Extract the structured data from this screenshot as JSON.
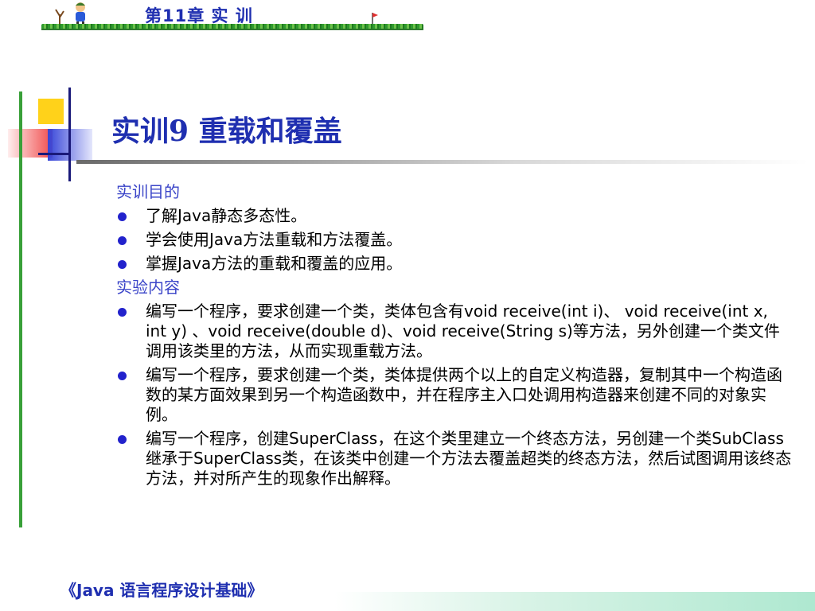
{
  "header": {
    "chapter_title": "第11章  实 训"
  },
  "slide": {
    "title": "实训9   重载和覆盖"
  },
  "content": {
    "sections": [
      {
        "heading": "实训目的",
        "items": [
          "了解Java静态多态性。",
          "学会使用Java方法重载和方法覆盖。",
          "掌握Java方法的重载和覆盖的应用。"
        ]
      },
      {
        "heading": "实验内容",
        "items": [
          "编写一个程序，要求创建一个类，类体包含有void receive(int i)、 void receive(int x, int y) 、void  receive(double d)、void  receive(String s)等方法，另外创建一个类文件调用该类里的方法，从而实现重载方法。",
          "编写一个程序，要求创建一个类，类体提供两个以上的自定义构造器，复制其中一个构造函数的某方面效果到另一个构造函数中，并在程序主入口处调用构造器来创建不同的对象实例。",
          "编写一个程序，创建SuperClass，在这个类里建立一个终态方法，另创建一个类SubClass继承于SuperClass类，在该类中创建一个方法去覆盖超类的终态方法，然后试图调用该终态方法，并对所产生的现象作出解释。"
        ]
      }
    ]
  },
  "footer": {
    "book_title": "《Java 语言程序设计基础》"
  }
}
